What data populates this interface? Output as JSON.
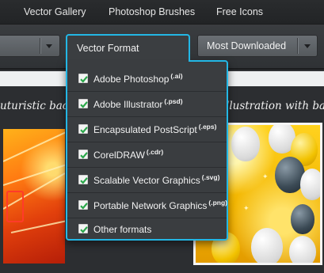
{
  "topnav": {
    "items": [
      "Vector Gallery",
      "Photoshop Brushes",
      "Free Icons"
    ]
  },
  "filters": {
    "format_dropdown": {
      "label": "Vector Format",
      "options": [
        {
          "label": "Adobe Photoshop",
          "ext": "(.ai)",
          "checked": true
        },
        {
          "label": "Adobe Illustrator",
          "ext": "(.psd)",
          "checked": true
        },
        {
          "label": "Encapsulated PostScript",
          "ext": "(.eps)",
          "checked": true
        },
        {
          "label": "CorelDRAW",
          "ext": "(.cdr)",
          "checked": true
        },
        {
          "label": "Scalable Vector Graphics",
          "ext": "(.svg)",
          "checked": true
        },
        {
          "label": "Portable Network Graphics",
          "ext": "(.png)",
          "checked": true
        },
        {
          "label": "Other formats",
          "ext": "",
          "checked": true
        }
      ]
    },
    "sort_select": {
      "value": "Most Downloaded"
    }
  },
  "gallery": {
    "items": [
      {
        "caption": "uturistic back"
      },
      {
        "caption": "llustration with ball"
      }
    ]
  },
  "colors": {
    "accent": "#23b7e5",
    "panel": "#3a3d40",
    "background": "#2e3033"
  }
}
